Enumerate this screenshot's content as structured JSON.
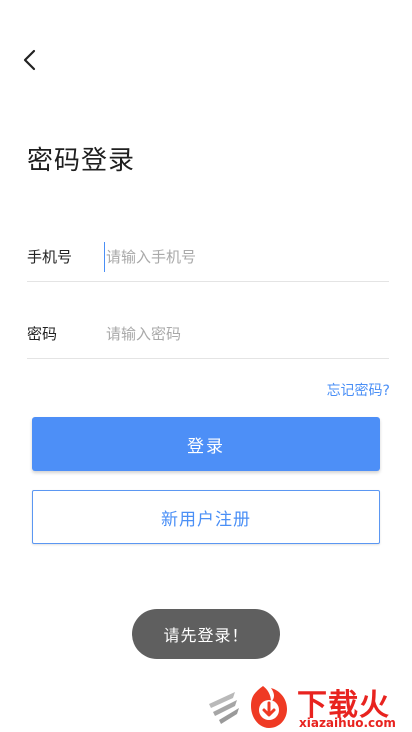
{
  "header": {
    "back_icon": "chevron-left-icon"
  },
  "title": "密码登录",
  "form": {
    "phone": {
      "label": "手机号",
      "placeholder": "请输入手机号",
      "value": ""
    },
    "password": {
      "label": "密码",
      "placeholder": "请输入密码",
      "value": ""
    },
    "forgot_label": "忘记密码?"
  },
  "actions": {
    "login_label": "登录",
    "register_label": "新用户注册"
  },
  "toast": {
    "message": "请先登录！"
  },
  "watermark": {
    "brand": "下载火",
    "domain": "xiazaihuo.com"
  },
  "colors": {
    "accent": "#4d8ff7",
    "link": "#4a8ff6",
    "toast_bg": "#5f5f5f",
    "watermark": "#e8231f"
  }
}
